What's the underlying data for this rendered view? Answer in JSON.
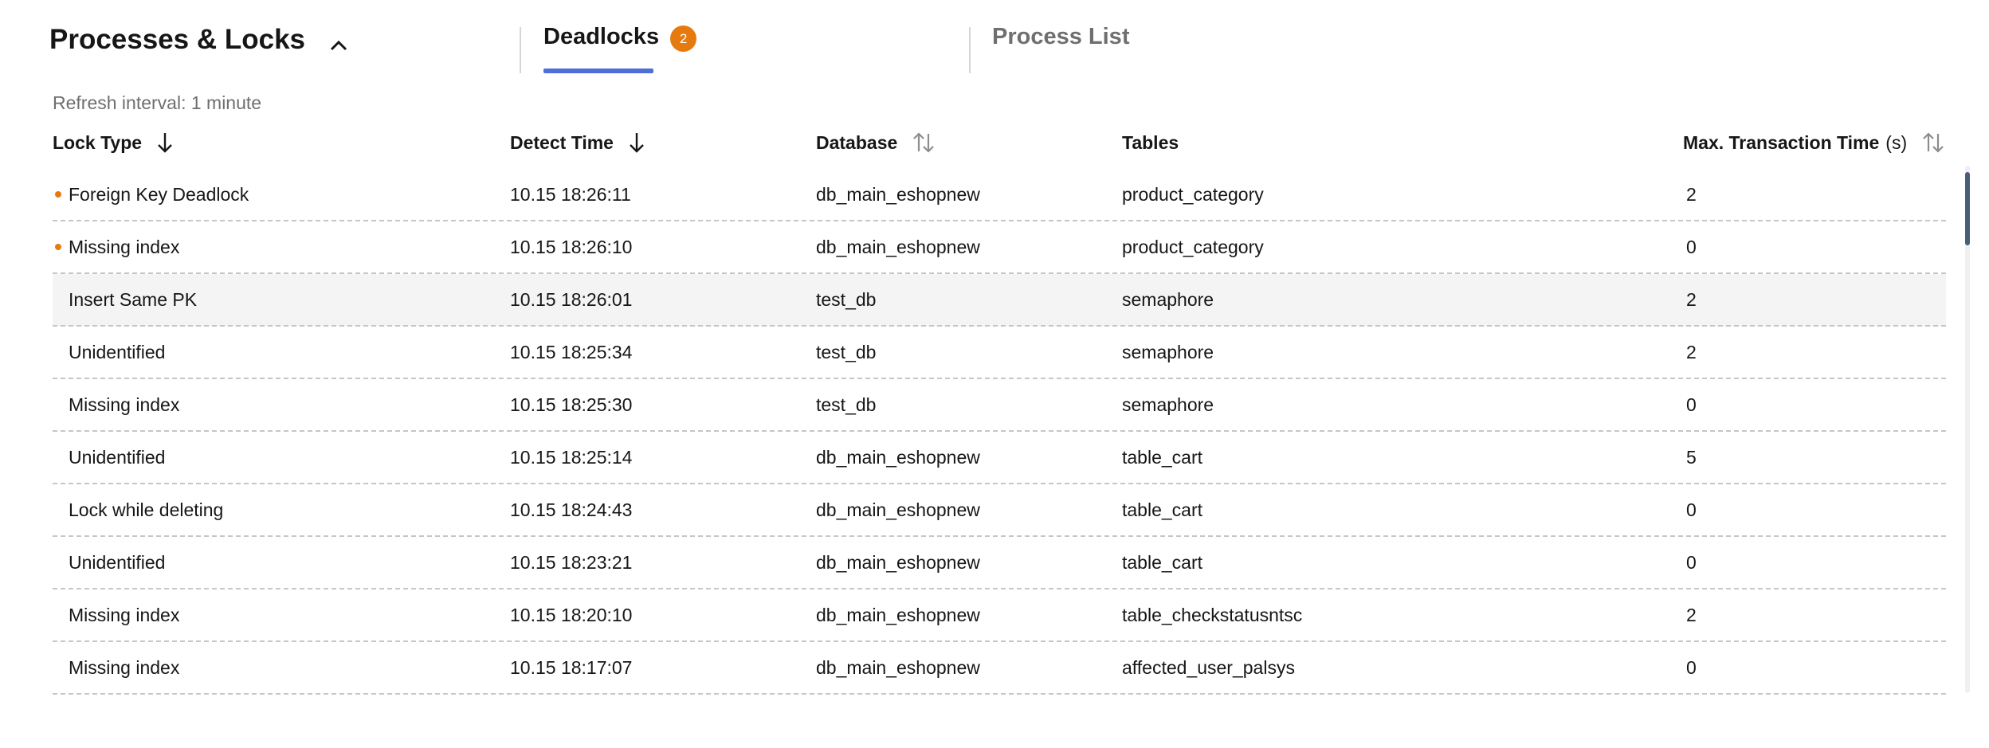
{
  "section": {
    "title": "Processes & Locks",
    "collapse_icon": "chevron-up-icon"
  },
  "tabs": [
    {
      "label": "Deadlocks",
      "badge": "2",
      "active": true
    },
    {
      "label": "Process List",
      "active": false
    }
  ],
  "refresh_text": "Refresh interval: 1 minute",
  "columns": {
    "lock_type": "Lock Type",
    "detect_time": "Detect Time",
    "database": "Database",
    "tables": "Tables",
    "max_time": "Max. Transaction Time",
    "max_time_unit": "(s)"
  },
  "rows": [
    {
      "lock_type": "Foreign Key Deadlock",
      "detect_time": "10.15 18:26:11",
      "database": "db_main_eshopnew",
      "tables": "product_category",
      "max_time": "2",
      "marked": true
    },
    {
      "lock_type": "Missing index",
      "detect_time": "10.15 18:26:10",
      "database": "db_main_eshopnew",
      "tables": "product_category",
      "max_time": "0",
      "marked": true
    },
    {
      "lock_type": "Insert Same PK",
      "detect_time": "10.15 18:26:01",
      "database": "test_db",
      "tables": "semaphore",
      "max_time": "2",
      "marked": false
    },
    {
      "lock_type": "Unidentified",
      "detect_time": "10.15 18:25:34",
      "database": "test_db",
      "tables": "semaphore",
      "max_time": "2",
      "marked": false
    },
    {
      "lock_type": "Missing index",
      "detect_time": "10.15 18:25:30",
      "database": "test_db",
      "tables": "semaphore",
      "max_time": "0",
      "marked": false
    },
    {
      "lock_type": "Unidentified",
      "detect_time": "10.15 18:25:14",
      "database": "db_main_eshopnew",
      "tables": "table_cart",
      "max_time": "5",
      "marked": false
    },
    {
      "lock_type": "Lock while deleting",
      "detect_time": "10.15 18:24:43",
      "database": "db_main_eshopnew",
      "tables": "table_cart",
      "max_time": "0",
      "marked": false
    },
    {
      "lock_type": "Unidentified",
      "detect_time": "10.15 18:23:21",
      "database": "db_main_eshopnew",
      "tables": "table_cart",
      "max_time": "0",
      "marked": false
    },
    {
      "lock_type": "Missing index",
      "detect_time": "10.15 18:20:10",
      "database": "db_main_eshopnew",
      "tables": "table_checkstatusntsc",
      "max_time": "2",
      "marked": false
    },
    {
      "lock_type": "Missing index",
      "detect_time": "10.15 18:17:07",
      "database": "db_main_eshopnew",
      "tables": "affected_user_palsys",
      "max_time": "0",
      "marked": false
    }
  ],
  "colors": {
    "accent": "#4f6fd8",
    "badge": "#e67a0f",
    "row_highlight": "#f4f4f4"
  }
}
